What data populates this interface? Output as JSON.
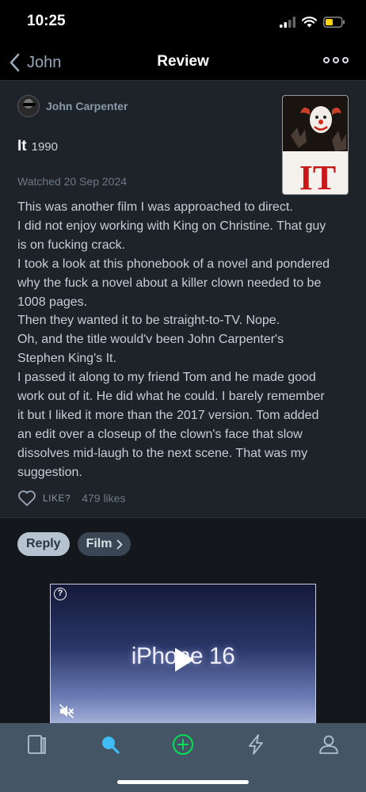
{
  "status_bar": {
    "time": "10:25"
  },
  "nav": {
    "back_label": "John",
    "title": "Review"
  },
  "review": {
    "author": "John Carpenter",
    "film_title": "It",
    "film_year": "1990",
    "poster_text": "IT",
    "watched": "Watched 20 Sep 2024",
    "text_lines": [
      "This was another film I was approached to direct.",
      "I did not enjoy working with King on Christine. That guy",
      "is on fucking crack.",
      "I took a look at this phonebook of a novel and pondered",
      "why the fuck a novel about a killer clown needed to be",
      "1008 pages.",
      "Then they wanted it to be straight-to-TV. Nope.",
      "Oh, and the title would'v been John Carpenter's",
      "Stephen King's It.",
      "I passed it along to my friend Tom and he made good",
      "work out of it. He did what he could. I barely remember",
      "it but I liked it more than the 2017 version. Tom added",
      "an edit over a closeup of the clown's face that slow",
      "dissolves mid-laugh to the next scene. That was my",
      "suggestion."
    ],
    "like_label": "LIKE?",
    "likes_count": "479 likes"
  },
  "actions": {
    "reply_label": "Reply",
    "film_label": "Film"
  },
  "ad": {
    "text": "iPhone 16",
    "help": "?"
  },
  "tabs": [
    "diary-icon",
    "search-icon",
    "add-icon",
    "activity-icon",
    "profile-icon"
  ],
  "colors": {
    "active_tab": "#40bcf4",
    "add_tab": "#00e054",
    "tab_bar": "#445566",
    "review_bg": "#1e2329"
  }
}
